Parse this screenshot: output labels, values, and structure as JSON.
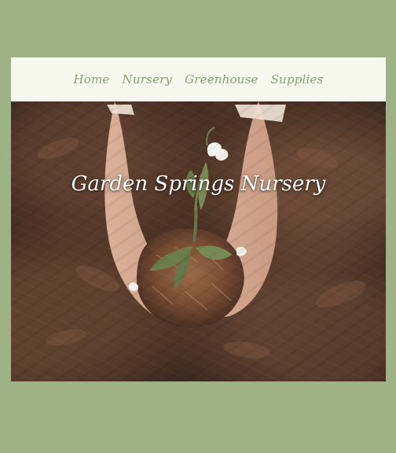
{
  "nav": {
    "items": [
      {
        "label": "Home"
      },
      {
        "label": "Nursery"
      },
      {
        "label": "Greenhouse"
      },
      {
        "label": "Supplies"
      }
    ]
  },
  "hero": {
    "title": "Garden Springs Nursery"
  },
  "theme": {
    "page_background": "#9db285",
    "nav_background": "#f7f8ee",
    "nav_text": "#8aa070",
    "hero_text": "#ffffff"
  },
  "icons": {
    "hero_image": "hands-holding-seedling-image"
  }
}
